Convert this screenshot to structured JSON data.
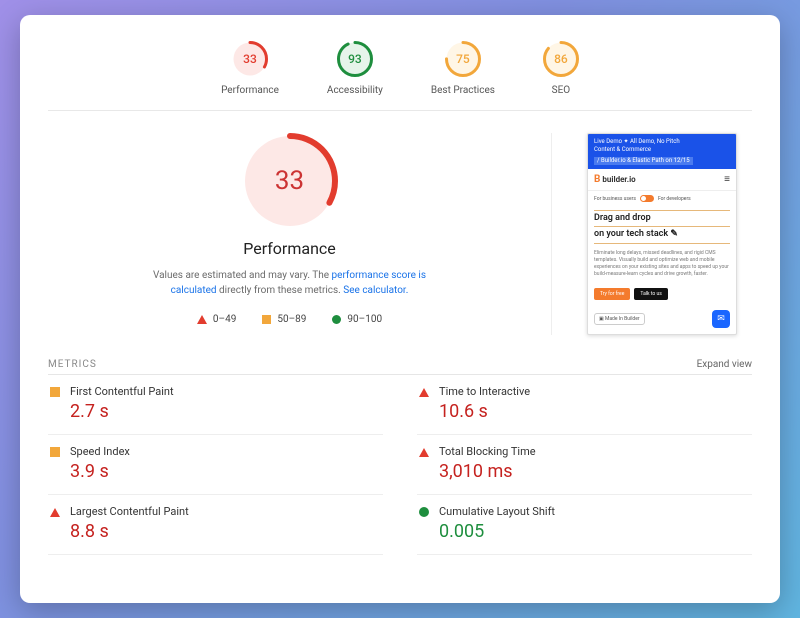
{
  "gauges": [
    {
      "score": "33",
      "label": "Performance",
      "color": "#e23c2e",
      "bg": "#fde8e6",
      "pct": 0.33
    },
    {
      "score": "93",
      "label": "Accessibility",
      "color": "#1e8e3e",
      "bg": "#e6f4ea",
      "pct": 0.93
    },
    {
      "score": "75",
      "label": "Best Practices",
      "color": "#f2a73b",
      "bg": "#fff6e6",
      "pct": 0.75
    },
    {
      "score": "86",
      "label": "SEO",
      "color": "#f2a73b",
      "bg": "#fff6e6",
      "pct": 0.86
    }
  ],
  "big_gauge": {
    "score": "33",
    "title": "Performance",
    "color": "#e23c2e",
    "bg": "#fde8e6",
    "pct": 0.33
  },
  "desc": {
    "pre": "Values are estimated and may vary. The ",
    "link1": "performance score is calculated",
    "mid": " directly from these metrics. ",
    "link2": "See calculator."
  },
  "legend": [
    {
      "shape": "tri",
      "range": "0–49"
    },
    {
      "shape": "sq",
      "range": "50–89"
    },
    {
      "shape": "circ",
      "range": "90–100"
    }
  ],
  "preview": {
    "top1": "Live Demo ✦ All Demo, No Pitch",
    "top2": "Content & Commerce",
    "top3": "/ Builder.io & Elastic Path on 12/15",
    "brand": "builder.io",
    "tog_left": "For business users",
    "tog_right": "For developers",
    "hl1": "Drag and drop",
    "hl2": "on your tech stack",
    "body": "Eliminate long delays, missed deadlines, and rigid CMS templates. Visually build and optimize web and mobile experiences on your existing sites and apps to speed up your build-measure-learn cycles and drive growth, faster.",
    "cta1": "Try for free",
    "cta2": "Talk to us",
    "badge": "Made In Builder"
  },
  "metrics_title": "METRICS",
  "expand": "Expand view",
  "metrics": [
    {
      "mark": "sq",
      "name": "First Contentful Paint",
      "val": "2.7 s",
      "cls": "red"
    },
    {
      "mark": "tri",
      "name": "Time to Interactive",
      "val": "10.6 s",
      "cls": "red"
    },
    {
      "mark": "sq",
      "name": "Speed Index",
      "val": "3.9 s",
      "cls": "red"
    },
    {
      "mark": "tri",
      "name": "Total Blocking Time",
      "val": "3,010 ms",
      "cls": "red"
    },
    {
      "mark": "tri",
      "name": "Largest Contentful Paint",
      "val": "8.8 s",
      "cls": "red"
    },
    {
      "mark": "circ",
      "name": "Cumulative Layout Shift",
      "val": "0.005",
      "cls": "green"
    }
  ]
}
